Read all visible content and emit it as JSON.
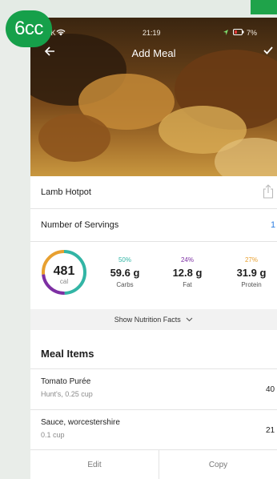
{
  "brand": {
    "logo_text": "6cc"
  },
  "status_bar": {
    "carrier": "O2-UK",
    "time": "21:19",
    "battery": "7%"
  },
  "navbar": {
    "title": "Add Meal"
  },
  "meal": {
    "name": "Lamb Hotpot"
  },
  "servings": {
    "label": "Number of Servings",
    "value": "1"
  },
  "calories": {
    "value": "481",
    "unit": "cal"
  },
  "macros": [
    {
      "percent": "50%",
      "grams": "59.6 g",
      "name": "Carbs",
      "color": "#32b5a5",
      "fraction": 0.5
    },
    {
      "percent": "24%",
      "grams": "12.8 g",
      "name": "Fat",
      "color": "#7d2fa3",
      "fraction": 0.24
    },
    {
      "percent": "27%",
      "grams": "31.9 g",
      "name": "Protein",
      "color": "#e8a030",
      "fraction": 0.27
    }
  ],
  "nutrition_toggle": "Show Nutrition Facts",
  "meal_items": {
    "title": "Meal Items",
    "items": [
      {
        "name": "Tomato Purée",
        "detail": "Hunt's, 0.25 cup",
        "calories": "40"
      },
      {
        "name": "Sauce, worcestershire",
        "detail": "0.1 cup",
        "calories": "21"
      }
    ]
  },
  "footer": {
    "edit": "Edit",
    "copy": "Copy"
  },
  "colors": {
    "brand": "#16a04a",
    "link": "#2f7fe0"
  }
}
